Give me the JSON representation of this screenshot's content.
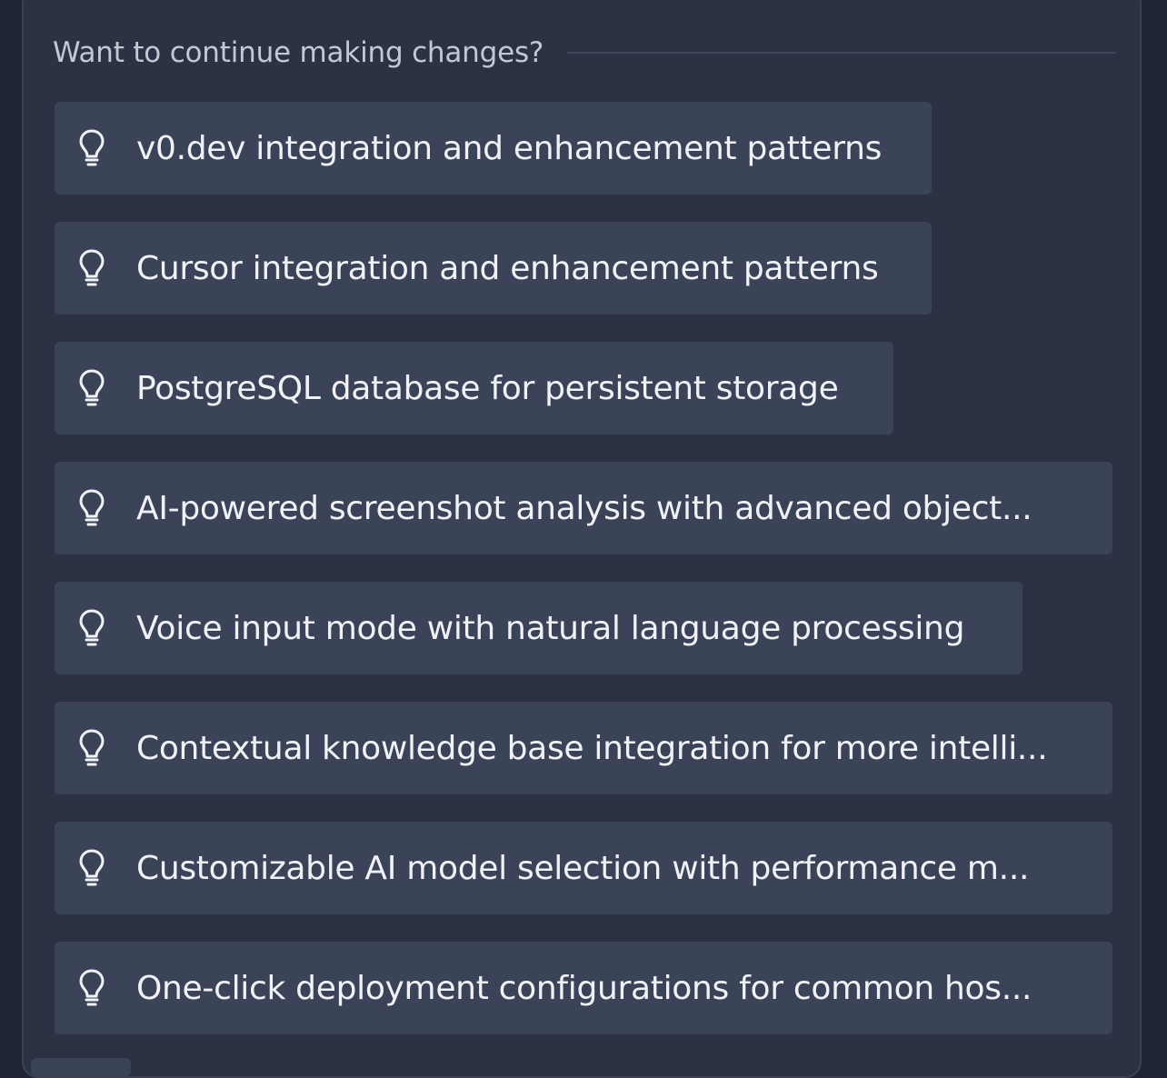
{
  "panel": {
    "title": "Want to continue making changes?"
  },
  "suggestions": [
    {
      "label": "v0.dev integration and enhancement patterns",
      "icon": "lightbulb-icon"
    },
    {
      "label": "Cursor integration and enhancement patterns",
      "icon": "lightbulb-icon"
    },
    {
      "label": "PostgreSQL database for persistent storage",
      "icon": "lightbulb-icon"
    },
    {
      "label": "AI-powered screenshot analysis with advanced object...",
      "icon": "lightbulb-icon"
    },
    {
      "label": "Voice input mode with natural language processing",
      "icon": "lightbulb-icon"
    },
    {
      "label": "Contextual knowledge base integration for more intelli...",
      "icon": "lightbulb-icon"
    },
    {
      "label": "Customizable AI model selection with performance m...",
      "icon": "lightbulb-icon"
    },
    {
      "label": "One-click deployment configurations for common hos...",
      "icon": "lightbulb-icon"
    }
  ],
  "colors": {
    "background": "#1e2433",
    "panel": "#2b3244",
    "chip": "#3b4358",
    "text": "#f0f2f6",
    "muted_text": "#c3c8d2"
  }
}
